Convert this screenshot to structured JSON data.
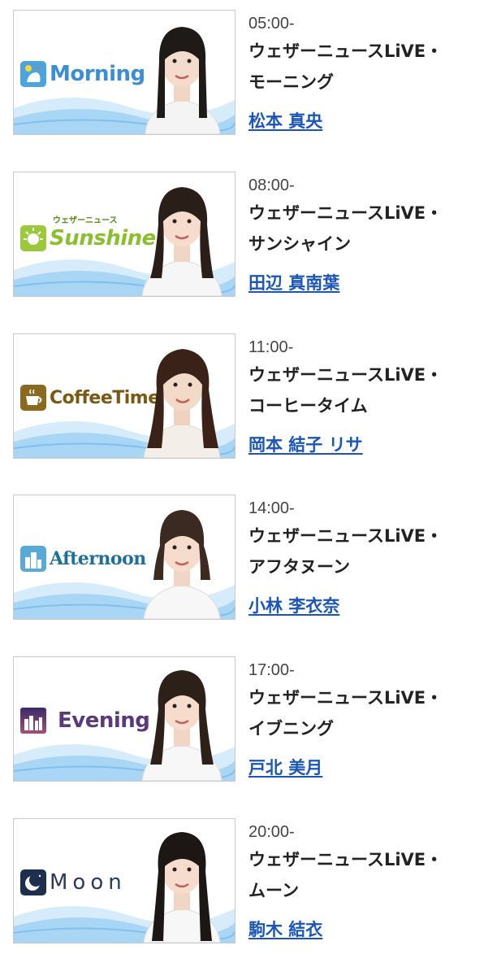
{
  "programs": [
    {
      "time": "05:00-",
      "title_line1": "ウェザーニュースLiVE・",
      "title_line2": "モーニング",
      "caster": "松本 真央",
      "logo_text": "Morning",
      "logo_subtext": "",
      "logo_color": "#3a8fd4",
      "icon_color": "#4aa4e0",
      "icon_name": "rooster-icon"
    },
    {
      "time": "08:00-",
      "title_line1": "ウェザーニュースLiVE・",
      "title_line2": "サンシャイン",
      "caster": "田辺 真南葉",
      "logo_text": "Sunshine",
      "logo_subtext": "ウェザーニュース",
      "logo_color": "#8bbf2e",
      "icon_color": "#9bc93a",
      "icon_name": "sun-icon"
    },
    {
      "time": "11:00-",
      "title_line1": "ウェザーニュースLiVE・",
      "title_line2": "コーヒータイム",
      "caster": "岡本 結子 リサ",
      "logo_text": "CoffeeTime",
      "logo_subtext": "",
      "logo_color": "#7a5a12",
      "icon_color": "#8a6a1c",
      "icon_name": "coffee-cup-icon"
    },
    {
      "time": "14:00-",
      "title_line1": "ウェザーニュースLiVE・",
      "title_line2": "アフタヌーン",
      "caster": "小林 李衣奈",
      "logo_text": "Afternoon",
      "logo_subtext": "",
      "logo_color": "#1f6f9a",
      "icon_color": "#5aaad8",
      "icon_name": "city-buildings-icon"
    },
    {
      "time": "17:00-",
      "title_line1": "ウェザーニュースLiVE・",
      "title_line2": "イブニング",
      "caster": "戸北 美月",
      "logo_text": "Evening",
      "logo_subtext": "",
      "logo_color": "#5a3a7a",
      "icon_color": "#6a3f86",
      "icon_name": "sunset-city-icon"
    },
    {
      "time": "20:00-",
      "title_line1": "ウェザーニュースLiVE・",
      "title_line2": "ムーン",
      "caster": "駒木 結衣",
      "logo_text": "Moon",
      "logo_subtext": "",
      "logo_color": "#2a3a5a",
      "icon_color": "#1e2e4e",
      "icon_name": "crescent-moon-icon"
    }
  ]
}
